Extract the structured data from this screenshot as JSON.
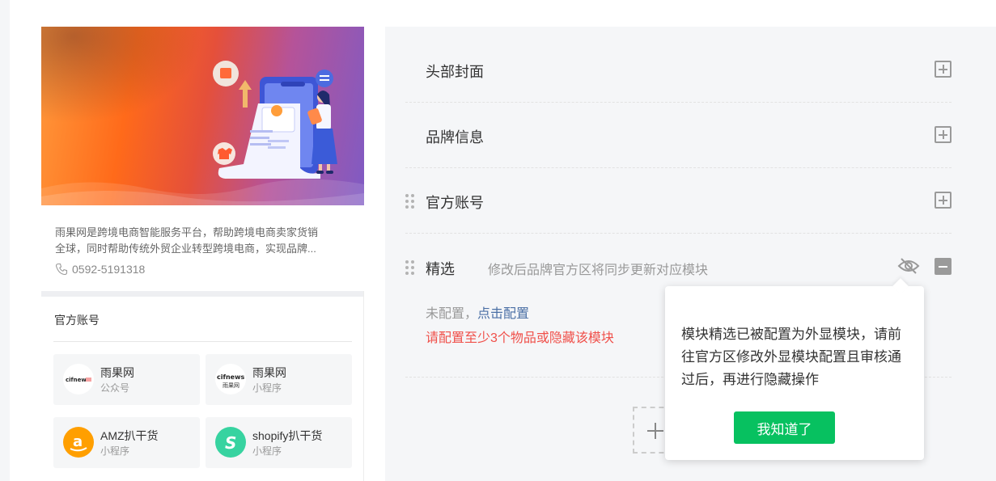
{
  "preview": {
    "intro_lines": [
      "雨果网是跨境电商智能服务平台，帮助跨境电商卖家货销",
      "全球，同时帮助传统外贸企业转型跨境电商，实现品牌..."
    ],
    "phone": "0592-5191318",
    "accounts_title": "官方账号",
    "accounts": [
      {
        "name": "雨果网",
        "type": "公众号",
        "logo_text": "cifnews"
      },
      {
        "name": "雨果网",
        "type": "小程序",
        "logo_text": "cifnews",
        "logo_sub": "雨果网"
      },
      {
        "name": "AMZ扒干货",
        "type": "小程序",
        "logo_text": "a"
      },
      {
        "name": "shopify扒干货",
        "type": "小程序",
        "logo_text": "S"
      }
    ]
  },
  "config": {
    "rows": [
      {
        "title": "头部封面",
        "toggle": "plus"
      },
      {
        "title": "品牌信息",
        "toggle": "plus"
      },
      {
        "title": "官方账号",
        "toggle": "plus"
      },
      {
        "title": "精选",
        "hint": "修改后品牌官方区将同步更新对应模块",
        "toggle": "minus"
      }
    ],
    "status_prefix": "未配置，",
    "status_link": "点击配置",
    "error": "请配置至少3个物品或隐藏该模块"
  },
  "tooltip": {
    "lines": [
      "模块精选已被配置为外显模块，请前",
      "往官方区修改外显模块配置且审核通",
      "过后，再进行隐藏操作"
    ],
    "button": "我知道了"
  },
  "colors": {
    "accent_green": "#07c160",
    "error_red": "#f0504a",
    "link_blue": "#4a6fa5",
    "panel_bg": "#f5f6f8"
  }
}
